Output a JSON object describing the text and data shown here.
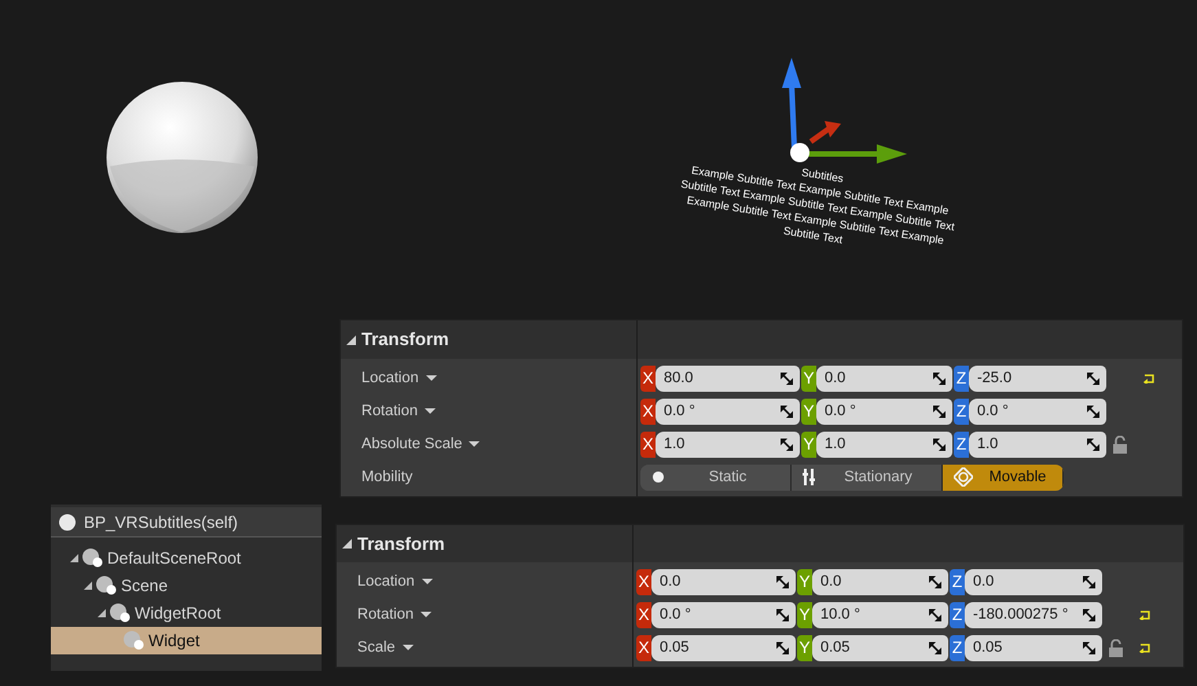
{
  "viewport": {
    "subtitle_lines": [
      "Subtitles",
      "Example Subtitle Text Example Subtitle Text Example",
      "Subtitle Text Example Subtitle Text Example Subtitle Text",
      "Example Subtitle Text Example Subtitle Text Example",
      "Subtitle Text"
    ]
  },
  "details_panels": [
    {
      "title": "Transform",
      "rows": [
        {
          "kind": "vector",
          "label": "Location",
          "values": [
            {
              "axis": "X",
              "value": "80.0"
            },
            {
              "axis": "Y",
              "value": "0.0"
            },
            {
              "axis": "Z",
              "value": "-25.0"
            }
          ],
          "reset": true
        },
        {
          "kind": "vector",
          "label": "Rotation",
          "values": [
            {
              "axis": "X",
              "value": "0.0 °"
            },
            {
              "axis": "Y",
              "value": "0.0 °"
            },
            {
              "axis": "Z",
              "value": "0.0 °"
            }
          ],
          "reset": false
        },
        {
          "kind": "vector",
          "label": "Absolute Scale",
          "values": [
            {
              "axis": "X",
              "value": "1.0"
            },
            {
              "axis": "Y",
              "value": "1.0"
            },
            {
              "axis": "Z",
              "value": "1.0"
            }
          ],
          "reset": false,
          "locked": false
        },
        {
          "kind": "mobility",
          "label": "Mobility",
          "options": [
            {
              "label": "Static",
              "selected": false
            },
            {
              "label": "Stationary",
              "selected": false
            },
            {
              "label": "Movable",
              "selected": true
            }
          ]
        }
      ]
    },
    {
      "title": "Transform",
      "rows": [
        {
          "kind": "vector",
          "label": "Location",
          "values": [
            {
              "axis": "X",
              "value": "0.0"
            },
            {
              "axis": "Y",
              "value": "0.0"
            },
            {
              "axis": "Z",
              "value": "0.0"
            }
          ],
          "reset": false
        },
        {
          "kind": "vector",
          "label": "Rotation",
          "values": [
            {
              "axis": "X",
              "value": "0.0 °"
            },
            {
              "axis": "Y",
              "value": "10.0 °"
            },
            {
              "axis": "Z",
              "value": "-180.000275 °"
            }
          ],
          "reset": true
        },
        {
          "kind": "vector",
          "label": "Scale",
          "values": [
            {
              "axis": "X",
              "value": "0.05"
            },
            {
              "axis": "Y",
              "value": "0.05"
            },
            {
              "axis": "Z",
              "value": "0.05"
            }
          ],
          "reset": true,
          "locked": false
        }
      ]
    }
  ],
  "components": {
    "root": "BP_VRSubtitles(self)",
    "tree": [
      {
        "label": "DefaultSceneRoot",
        "expanded": true,
        "selected": false,
        "children": [
          {
            "label": "Scene",
            "expanded": true,
            "selected": false,
            "children": [
              {
                "label": "WidgetRoot",
                "expanded": true,
                "selected": false,
                "children": [
                  {
                    "label": "Widget",
                    "selected": true
                  }
                ]
              }
            ]
          }
        ]
      }
    ]
  }
}
